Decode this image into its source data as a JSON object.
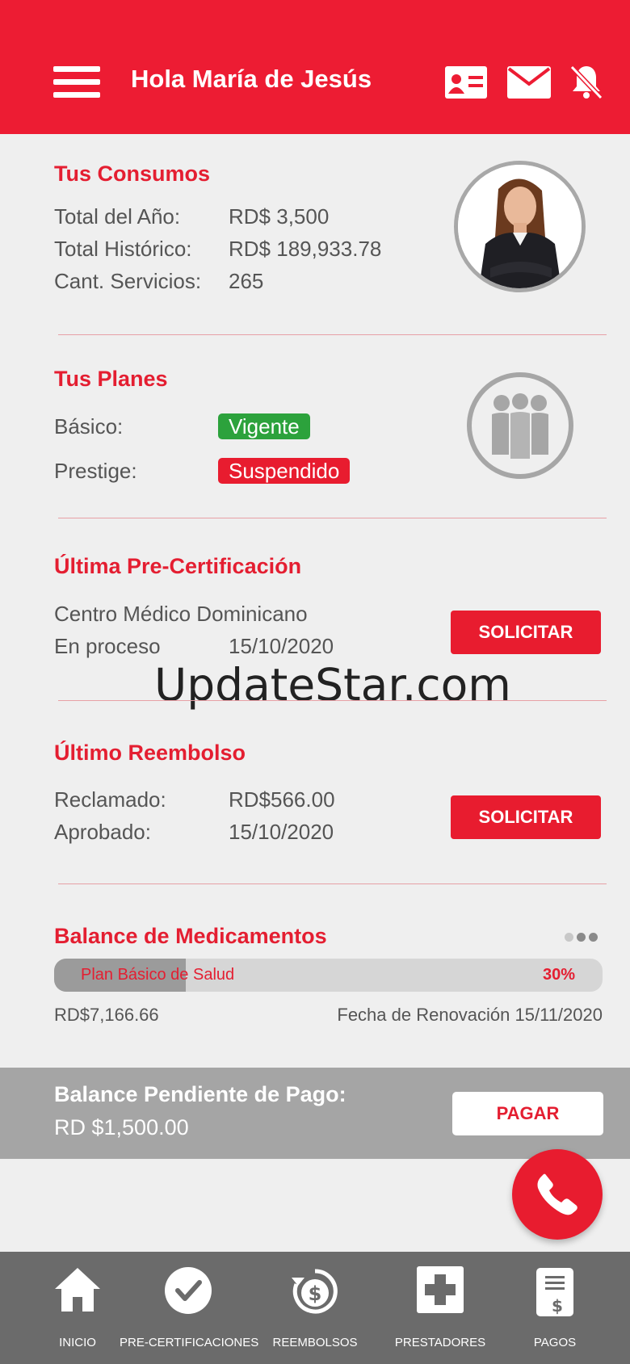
{
  "header": {
    "greeting": "Hola María de Jesús",
    "background_color": "#ed1c33"
  },
  "consumos": {
    "title": "Tus Consumos",
    "rows": [
      {
        "label": "Total del Año:",
        "value": "RD$ 3,500"
      },
      {
        "label": "Total Histórico:",
        "value": "RD$ 189,933.78"
      },
      {
        "label": "Cant. Servicios:",
        "value": "265"
      }
    ]
  },
  "planes": {
    "title": "Tus Planes",
    "rows": [
      {
        "label": "Básico:",
        "status": "Vigente",
        "status_color": "#2ca23c"
      },
      {
        "label": "Prestige:",
        "status": "Suspendido",
        "status_color": "#e81c2f"
      }
    ]
  },
  "precert": {
    "title": "Última Pre-Certificación",
    "provider": "Centro Médico Dominicano",
    "status_label": "En proceso",
    "date": "15/10/2020",
    "button": "SOLICITAR"
  },
  "reembolso": {
    "title": "Último Reembolso",
    "rows": [
      {
        "label": "Reclamado:",
        "value": "RD$566.00"
      },
      {
        "label": "Aprobado:",
        "value": "15/10/2020"
      }
    ],
    "button": "SOLICITAR"
  },
  "medicamentos": {
    "title": "Balance de Medicamentos",
    "plan_label": "Plan Básico de Salud",
    "percent_text": "30%",
    "percent": 0.24,
    "amount": "RD$7,166.66",
    "renewal": "Fecha de Renovación 15/11/2020"
  },
  "balance": {
    "title": "Balance Pendiente de Pago:",
    "amount": "RD $1,500.00",
    "button": "PAGAR"
  },
  "watermark": "UpdateStar.com",
  "nav": {
    "items": [
      {
        "label": "INICIO",
        "icon": "home-icon"
      },
      {
        "label": "PRE-CERTIFICACIONES",
        "icon": "check-circle-icon"
      },
      {
        "label": "REEMBOLSOS",
        "icon": "refund-dollar-icon"
      },
      {
        "label": "PRESTADORES",
        "icon": "medical-cross-icon"
      },
      {
        "label": "PAGOS",
        "icon": "invoice-icon"
      }
    ]
  },
  "colors": {
    "accent": "#e41e31",
    "nav_bg": "#6b6b6b",
    "balance_bg": "#a5a5a5"
  }
}
